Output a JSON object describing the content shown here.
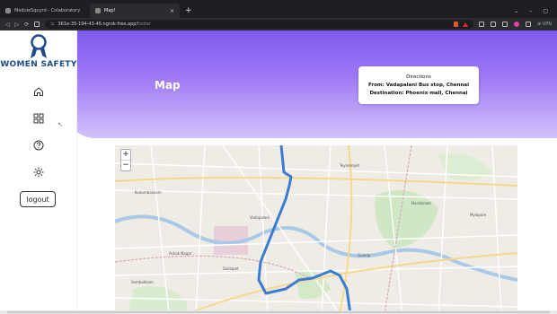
{
  "browser": {
    "tabs": [
      {
        "title": "ModuleSquyrd - Colaboratory",
        "active": false
      },
      {
        "title": "Map!",
        "active": true
      }
    ],
    "new_tab": "+",
    "close_tab": "×",
    "window_controls": [
      "⌄",
      "–",
      "▢"
    ],
    "nav": {
      "back": "◁",
      "forward": "▷",
      "reload": "⟳"
    },
    "url_prefix": "⇆",
    "url": "361e-35-194-43-46.ngrok-free.app/",
    "url_path": "footer",
    "vpn_label": "⊕ VPN"
  },
  "app": {
    "brand": "WOMEN SAFETY",
    "logout_label": "logout",
    "page_title": "Map",
    "nav_icons": [
      "home-icon",
      "dashboard-icon",
      "help-icon",
      "settings-icon"
    ]
  },
  "directions": {
    "heading": "Directions",
    "from_line": "From: Vadapalani Bus stop, Chennai",
    "destination_line": "Destination: Phoenix mall, Chennai"
  },
  "map": {
    "zoom_in": "+",
    "zoom_out": "−",
    "place_labels": [
      "Kodambakkam",
      "Teynampet",
      "Nandanam",
      "Saidapet",
      "Vadapalani",
      "Ashok Nagar",
      "Guindy",
      "Sembakkam",
      "Mylapore"
    ],
    "route_color": "#3a7bd5"
  }
}
